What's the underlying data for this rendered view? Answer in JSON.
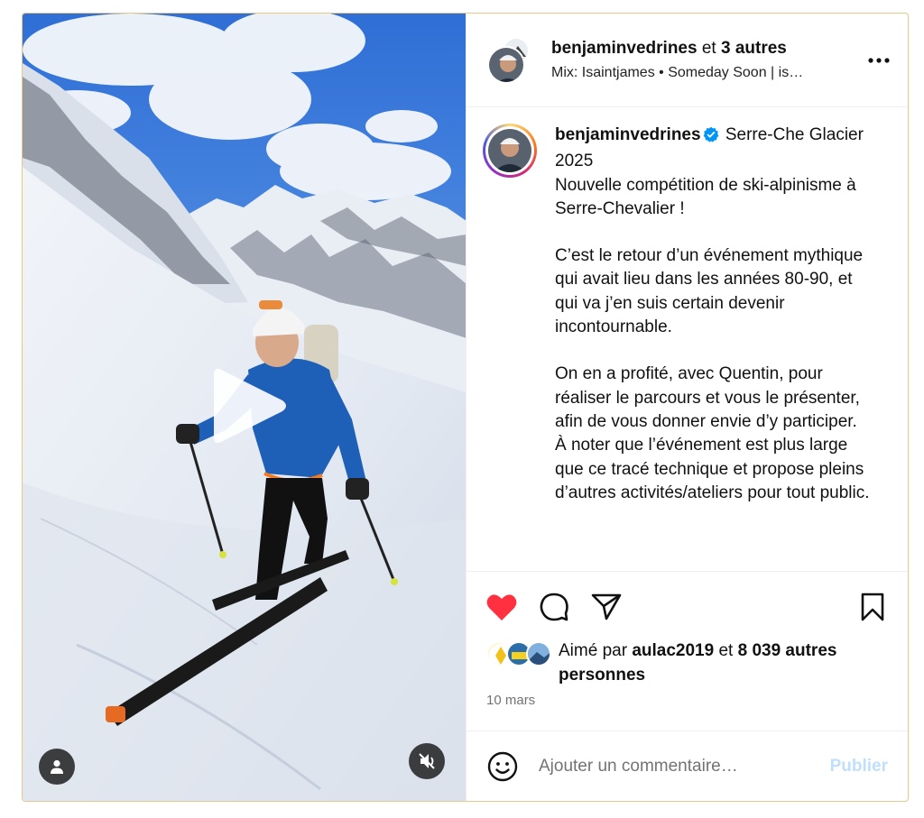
{
  "header": {
    "username": "benjaminvedrines",
    "conjunction": "et",
    "others": "3 autres",
    "audio": "Mix: Isaintjames • Someday Soon | is…"
  },
  "caption": {
    "username": "benjaminvedrines",
    "title": "Serre-Che Glacier 2025",
    "paragraphs": [
      "Nouvelle compétition de ski-alpinisme à Serre-Chevalier !",
      "C’est le retour d’un événement mythique qui avait lieu dans les années 80-90, et qui va j’en suis certain devenir incontournable.",
      "On en a profité, avec Quentin, pour réaliser le parcours et vous le présenter, afin de vous donner envie d’y participer.\nÀ noter que l’événement est plus large que ce tracé technique et propose pleins d’autres activités/ateliers pour tout public."
    ]
  },
  "likes": {
    "prefix": "Aimé par",
    "user": "aulac2019",
    "conjunction": "et",
    "count": "8 039 autres personnes"
  },
  "date": "10 mars",
  "comment": {
    "placeholder": "Ajouter un commentaire…",
    "publish_label": "Publier"
  },
  "colors": {
    "like_red": "#ff3040",
    "verified_blue": "#0095f6",
    "publish_disabled": "#c0dffd",
    "frame_border": "#e6c987"
  },
  "icons": {
    "like": "heart-filled-icon",
    "comment": "comment-bubble-icon",
    "share": "paper-plane-icon",
    "save": "bookmark-icon",
    "more": "ellipsis-icon",
    "play": "play-icon",
    "user": "user-icon",
    "mute": "speaker-muted-icon",
    "emoji": "smiley-icon",
    "verified": "verified-badge-icon"
  }
}
